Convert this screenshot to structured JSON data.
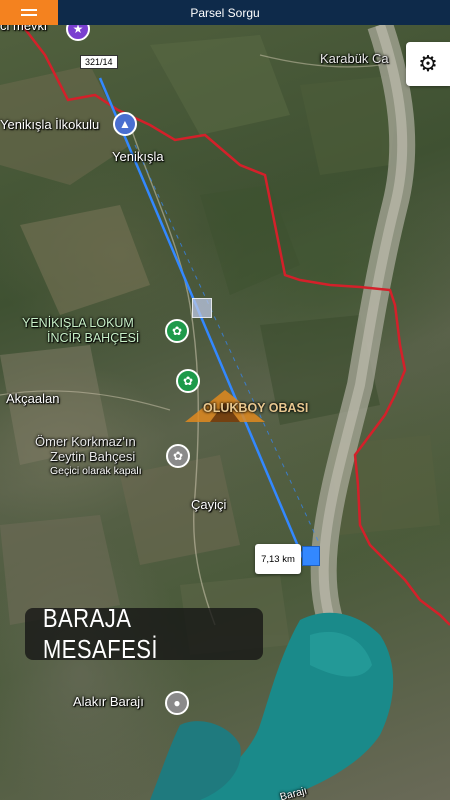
{
  "app": {
    "title": "Parsel Sorgu"
  },
  "map": {
    "labels": {
      "top_left_poi": "ci mevki",
      "karabuk": "Karabük Ca",
      "yenikisla_school": "Yenikışla İlkokulu",
      "yenikisla": "Yenikışla",
      "lokum_line1": "YENİKIŞLA LOKUM",
      "lokum_line2": "İNCİR BAHÇESİ",
      "camp": "OLUKBOY OBASI",
      "akcaalan": "Akçaalan",
      "omer_line1": "Ömer Korkmaz'ın",
      "omer_line2": "Zeytin Bahçesi",
      "omer_status": "Geçici olarak kapalı",
      "cayici": "Çayiçi",
      "dam": "Alakır Barajı",
      "dam_bottom": "Barajı"
    },
    "parcel_number": "321/14",
    "distance_label": "7,13 km",
    "caption": "BARAJA MESAFESİ",
    "icons": {
      "menu": "hamburger-menu-icon",
      "settings": "gear-icon",
      "poi_green": "flower-icon",
      "poi_grey": "flower-icon",
      "poi_purple": "landmark-icon",
      "school": "school-icon",
      "dam": "dam-pin-icon"
    },
    "colors": {
      "topbar": "#0e2a4a",
      "menu": "#f4821f",
      "boundary": "#d4202a",
      "measure_line": "#3388ff",
      "water": "#1a8a8a"
    }
  }
}
